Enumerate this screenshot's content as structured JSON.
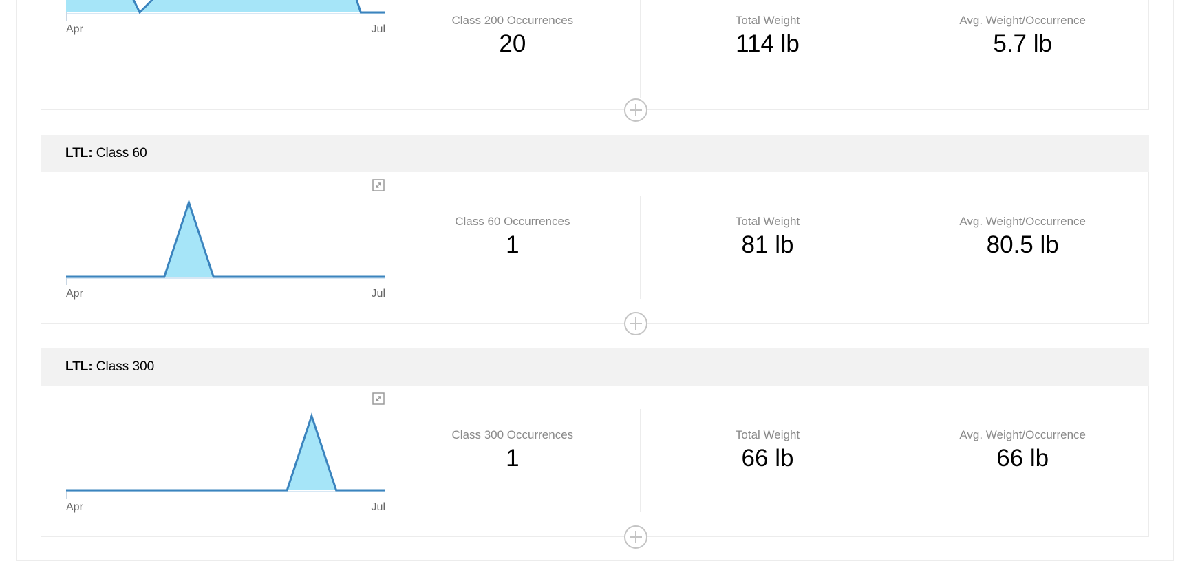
{
  "colors": {
    "line": "#3b84be",
    "fill": "#a6e5f8",
    "header_bg": "#f2f2f2"
  },
  "sections": [
    {
      "prefix": "",
      "title": "",
      "stats": [
        {
          "label": "Class 200 Occurrences",
          "value": "20"
        },
        {
          "label": "Total Weight",
          "value": "114 lb"
        },
        {
          "label": "Avg. Weight/Occurrence",
          "value": "5.7 lb"
        }
      ],
      "axis": {
        "start": "Apr",
        "end": "Jul"
      }
    },
    {
      "prefix": "LTL:",
      "title": "Class 60",
      "stats": [
        {
          "label": "Class 60 Occurrences",
          "value": "1"
        },
        {
          "label": "Total Weight",
          "value": "81 lb"
        },
        {
          "label": "Avg. Weight/Occurrence",
          "value": "80.5 lb"
        }
      ],
      "axis": {
        "start": "Apr",
        "end": "Jul"
      }
    },
    {
      "prefix": "LTL:",
      "title": "Class 300",
      "stats": [
        {
          "label": "Class 300 Occurrences",
          "value": "1"
        },
        {
          "label": "Total Weight",
          "value": "66 lb"
        },
        {
          "label": "Avg. Weight/Occurrence",
          "value": "66 lb"
        }
      ],
      "axis": {
        "start": "Apr",
        "end": "Jul"
      }
    }
  ],
  "chart_data": [
    {
      "type": "area",
      "x_ticks": [
        "Apr",
        "Jul"
      ],
      "values": [
        1,
        1,
        2,
        0,
        1,
        1,
        3,
        3,
        2,
        1,
        2,
        3,
        0,
        0
      ],
      "ylim": [
        0,
        3
      ]
    },
    {
      "type": "area",
      "x_ticks": [
        "Apr",
        "Jul"
      ],
      "values": [
        0,
        0,
        0,
        0,
        0,
        1,
        0,
        0,
        0,
        0,
        0,
        0,
        0,
        0
      ],
      "ylim": [
        0,
        1
      ]
    },
    {
      "type": "area",
      "x_ticks": [
        "Apr",
        "Jul"
      ],
      "values": [
        0,
        0,
        0,
        0,
        0,
        0,
        0,
        0,
        0,
        0,
        1,
        0,
        0,
        0
      ],
      "ylim": [
        0,
        1
      ]
    }
  ]
}
